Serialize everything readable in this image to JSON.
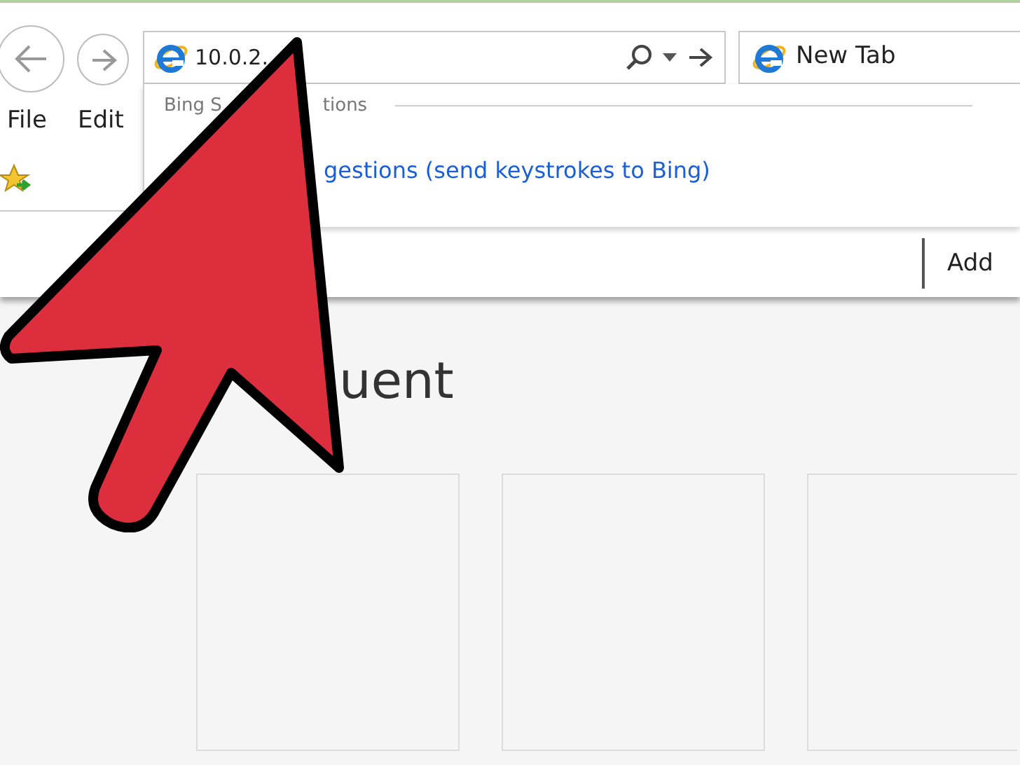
{
  "address_bar": {
    "value": "10.0.2."
  },
  "tab": {
    "label": "New Tab"
  },
  "menu": [
    {
      "label": "File"
    },
    {
      "label": "Edit"
    }
  ],
  "suggestions": {
    "heading_parts": [
      "Bing S",
      "tions"
    ],
    "link": "gestions (send keystrokes to Bing)"
  },
  "favorites_bar": {
    "button": "Add"
  },
  "page": {
    "heading": "uent"
  }
}
